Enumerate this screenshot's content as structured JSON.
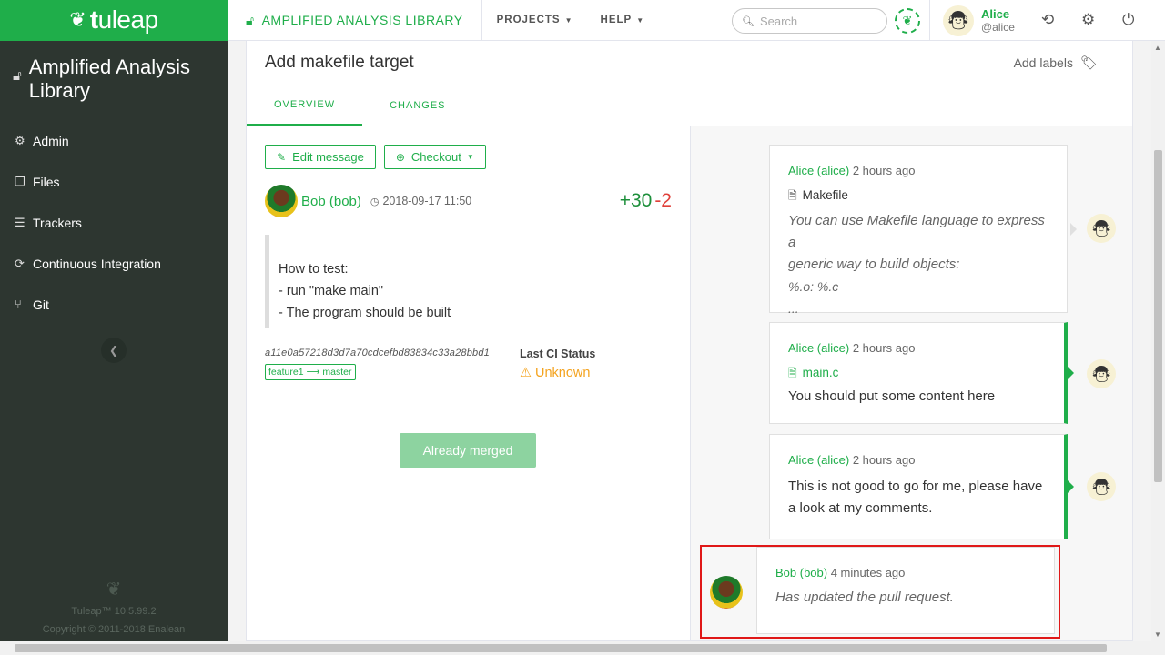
{
  "brand": {
    "logo_bold": "t",
    "logo_rest": "uleap"
  },
  "topbar": {
    "project_name": "AMPLIFIED ANALYSIS LIBRARY",
    "nav": [
      {
        "label": "PROJECTS"
      },
      {
        "label": "HELP"
      }
    ],
    "search_placeholder": "Search",
    "user": {
      "real_name": "Alice",
      "login": "@alice"
    }
  },
  "sidebar": {
    "project_name": "Amplified Analysis Library",
    "items": [
      {
        "label": "Admin",
        "icon": "gears-icon"
      },
      {
        "label": "Files",
        "icon": "files-icon"
      },
      {
        "label": "Trackers",
        "icon": "list-icon"
      },
      {
        "label": "Continuous Integration",
        "icon": "refresh-icon"
      },
      {
        "label": "Git",
        "icon": "git-icon"
      }
    ],
    "footer": {
      "version": "Tuleap™ 10.5.99.2",
      "copyright": "Copyright © 2011-2018 Enalean"
    }
  },
  "pull_request": {
    "title": "Add makefile target",
    "add_labels": "Add labels",
    "tabs": [
      {
        "label": "OVERVIEW"
      },
      {
        "label": "CHANGES"
      }
    ],
    "edit_message_label": "Edit message",
    "checkout_label": "Checkout",
    "author": "Bob (bob)",
    "date": "2018-09-17 11:50",
    "additions": "+30",
    "deletions": "-2",
    "description": [
      "How to test:",
      "- run \"make main\"",
      "- The program should be built"
    ],
    "sha": "a11e0a57218d3d7a70cdcefbd83834c33a28bbd1",
    "branch": "feature1 ⟶ master",
    "ci_label": "Last CI Status",
    "ci_status": "Unknown",
    "merged_label": "Already merged"
  },
  "timeline": [
    {
      "author": "Alice (alice)",
      "time": "2 hours ago",
      "file": "Makefile",
      "lines": [
        "You can use Makefile language to express a",
        "generic way to build objects:",
        "%.o: %.c",
        "..."
      ]
    },
    {
      "author": "Alice (alice)",
      "time": "2 hours ago",
      "file": "main.c",
      "text": "You should put some content here"
    },
    {
      "author": "Alice (alice)",
      "time": "2 hours ago",
      "lines": [
        "This is not good to go for me, please have",
        "a look at my comments."
      ]
    },
    {
      "author": "Bob (bob)",
      "time": "4 minutes ago",
      "text": "Has updated the pull request."
    }
  ],
  "colors": {
    "brand": "#1fae4a",
    "sidebar": "#2d3630",
    "warning": "#f4a31e",
    "deletions": "#e0403a",
    "highlight": "#e01818"
  }
}
